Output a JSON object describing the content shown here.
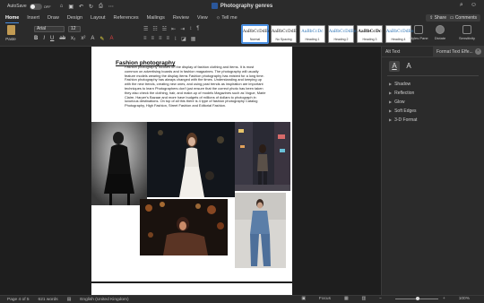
{
  "titlebar": {
    "autosave_label": "AutoSave",
    "autosave_state": "OFF",
    "title": "Photography genres",
    "search_icon": "search-icon",
    "account_icon": "account-icon"
  },
  "tabs": [
    "Home",
    "Insert",
    "Draw",
    "Design",
    "Layout",
    "References",
    "Mailings",
    "Review",
    "View"
  ],
  "tell_me": "Tell me",
  "share_label": "Share",
  "comments_label": "Comments",
  "ribbon": {
    "paste_label": "Paste",
    "font_name": "Arial",
    "font_size": "12",
    "styles": [
      {
        "sample": "AaBbCcDdEe",
        "name": "Normal"
      },
      {
        "sample": "AaBbCcDdEe",
        "name": "No Spacing"
      },
      {
        "sample": "AaBbCcDc",
        "name": "Heading 1"
      },
      {
        "sample": "AaBbCcDdEe",
        "name": "Heading 2"
      },
      {
        "sample": "AaBbCcDc",
        "name": "Heading 3"
      },
      {
        "sample": "AaBbCcDdEe",
        "name": "Heading 4"
      }
    ],
    "styles_pane_label": "Styles Pane",
    "dictate_label": "Dictate",
    "sensitivity_label": "Sensitivity"
  },
  "document": {
    "heading": "Fashion photography",
    "body": "Fashion photography focuses on the display of fashion clothing and items. It is most common on advertising boards and in fashion magazines. The photography will usually feature models wearing the display items Fashion photography has existed for a long time. Fashion photography has always changed with the times. Understanding and keeping up with the new trends, creating new ones, and using past trends as inspiration are important techniques to learn Photographers don't just ensure that the correct photo has been taken they also check the clothing, hair, and make-up of models Magazines such as Vogue, Marie Claire, Harper's Bazaar and more have budgets of millions of dollars to photograph in luxurious destinations. On top of all this there is 4 type of fashion photography Catalog Photography, High Fashion, Street Fashion and Editorial Fashion."
  },
  "pane": {
    "tabs": [
      "Alt Text",
      "Format Text Effe..."
    ],
    "items": [
      "Shadow",
      "Reflection",
      "Glow",
      "Soft Edges",
      "3-D Format"
    ]
  },
  "status": {
    "page": "Page 4 of 5",
    "words": "621 words",
    "language": "English (United Kingdom)",
    "focus": "Focus",
    "zoom": "100%"
  }
}
